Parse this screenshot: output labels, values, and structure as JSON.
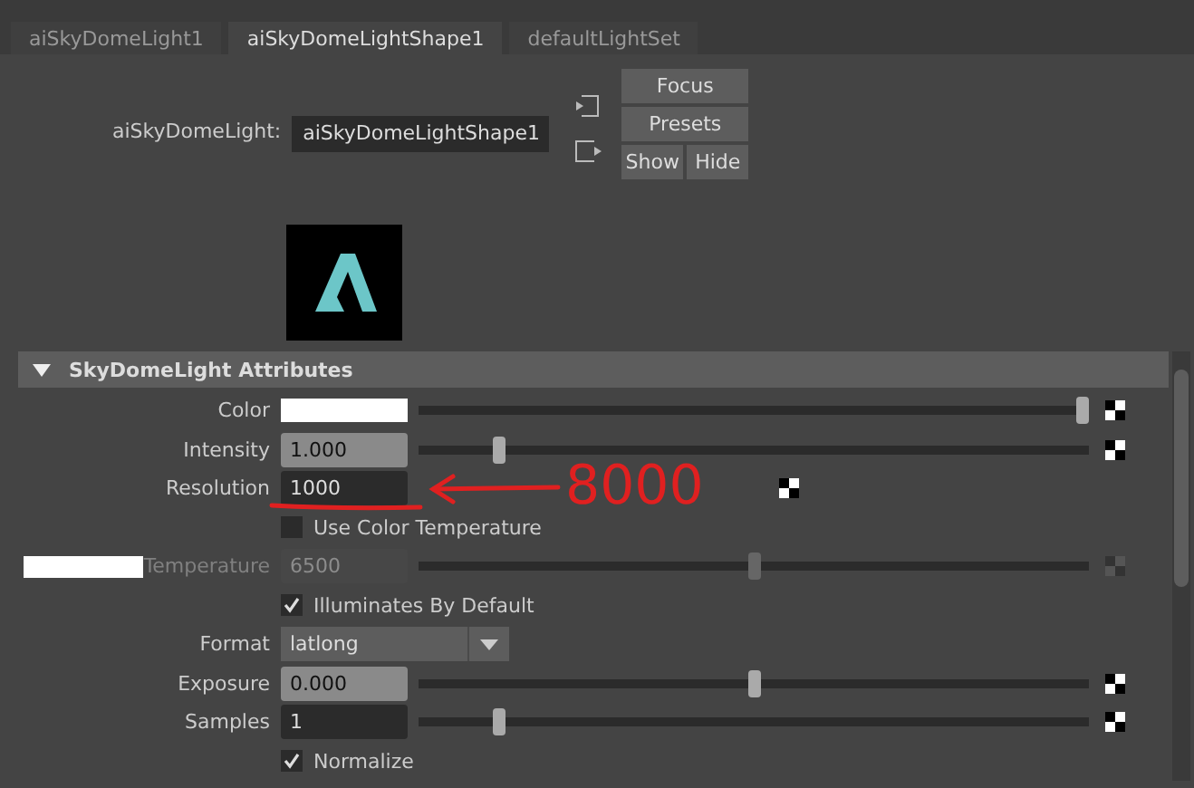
{
  "tabs": [
    {
      "label": "aiSkyDomeLight1",
      "selected": false
    },
    {
      "label": "aiSkyDomeLightShape1",
      "selected": true
    },
    {
      "label": "defaultLightSet",
      "selected": false
    }
  ],
  "node": {
    "label": "aiSkyDomeLight:",
    "value": "aiSkyDomeLightShape1"
  },
  "buttons": {
    "focus": "Focus",
    "presets": "Presets",
    "show": "Show",
    "hide": "Hide"
  },
  "section": {
    "title": "SkyDomeLight Attributes",
    "expanded": true
  },
  "attributes": [
    {
      "kind": "color",
      "label": "Color",
      "level": 0.99,
      "disabled": false
    },
    {
      "kind": "float",
      "label": "Intensity",
      "value": "1.000",
      "level": 0.12,
      "disabled": false
    },
    {
      "kind": "field",
      "label": "Resolution",
      "value": "1000",
      "disabled": false,
      "annotation": "8000"
    },
    {
      "kind": "checkbox",
      "label": "Use Color Temperature",
      "checked": false,
      "disabled": false
    },
    {
      "kind": "float",
      "label": "Temperature",
      "value": "6500",
      "level": 0.5,
      "disabled": true,
      "swatch": true
    },
    {
      "kind": "checkbox",
      "label": "Illuminates By Default",
      "checked": true,
      "disabled": false
    },
    {
      "kind": "dropdown",
      "label": "Format",
      "value": "latlong",
      "disabled": false
    },
    {
      "kind": "float",
      "label": "Exposure",
      "value": "0.000",
      "level": 0.5,
      "disabled": false
    },
    {
      "kind": "int",
      "label": "Samples",
      "value": "1",
      "level": 0.12,
      "disabled": false
    },
    {
      "kind": "checkbox",
      "label": "Normalize",
      "checked": true,
      "disabled": false
    }
  ]
}
